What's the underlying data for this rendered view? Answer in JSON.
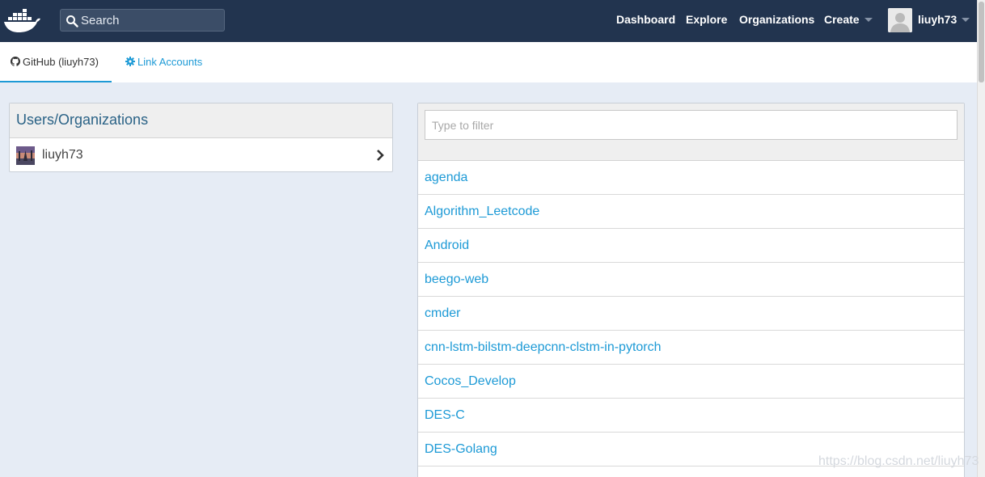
{
  "navbar": {
    "search_placeholder": "Search",
    "links": {
      "dashboard": "Dashboard",
      "explore": "Explore",
      "organizations": "Organizations",
      "create": "Create"
    },
    "username": "liuyh73"
  },
  "tabs": {
    "github": "GitHub (liuyh73)",
    "link_accounts": "Link Accounts"
  },
  "left_panel": {
    "title": "Users/Organizations",
    "items": [
      {
        "name": "liuyh73"
      }
    ]
  },
  "right_panel": {
    "filter_placeholder": "Type to filter",
    "repos": [
      "agenda",
      "Algorithm_Leetcode",
      "Android",
      "beego-web",
      "cmder",
      "cnn-lstm-bilstm-deepcnn-clstm-in-pytorch",
      "Cocos_Develop",
      "DES-C",
      "DES-Golang"
    ]
  },
  "watermark": "https://blog.csdn.net/liuyh73",
  "colors": {
    "navbar": "#22344f",
    "accent": "#1d9ad6",
    "page_background": "#e6ecf5"
  }
}
